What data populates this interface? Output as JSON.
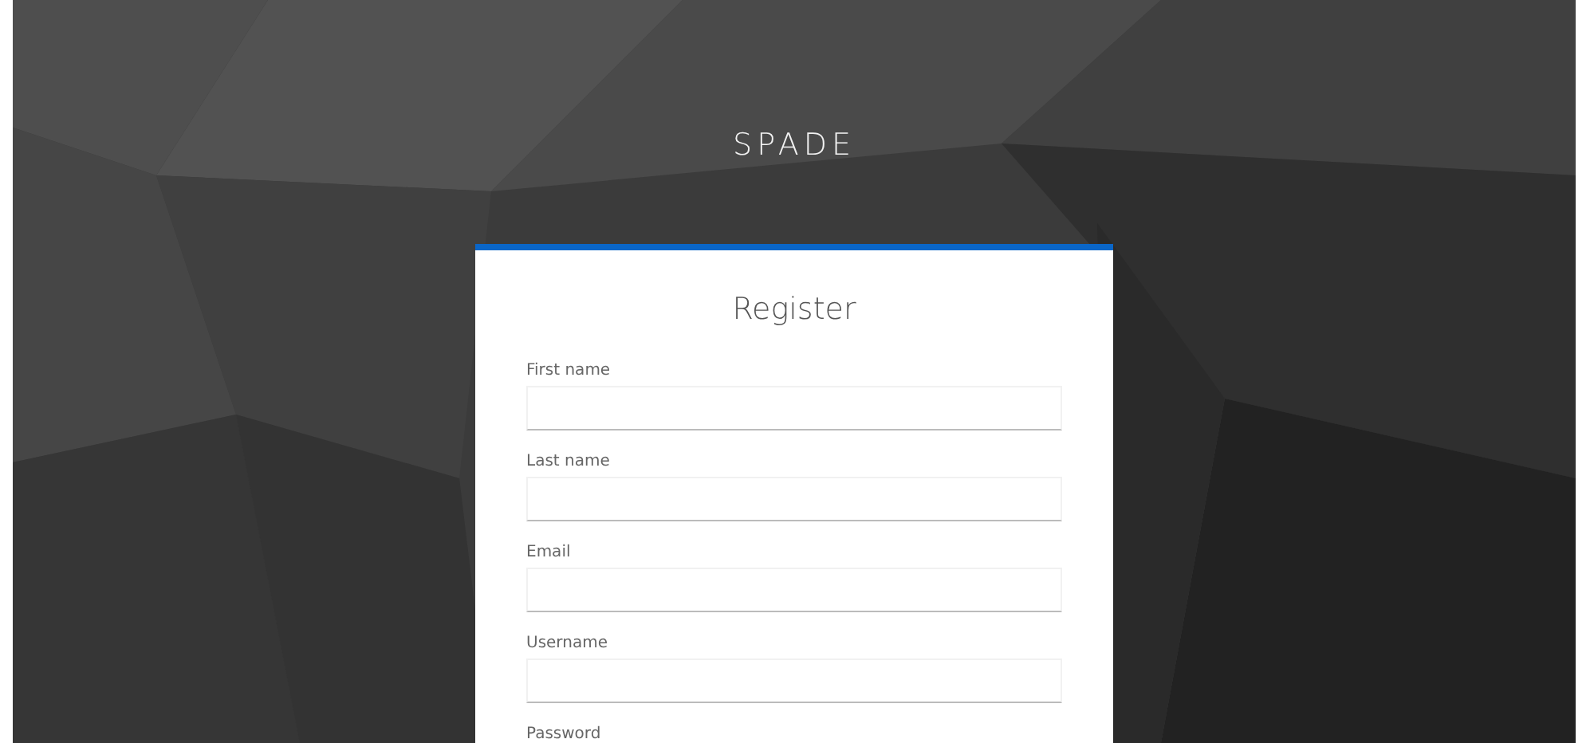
{
  "brand": "SPADE",
  "form": {
    "heading": "Register",
    "fields": [
      {
        "label": "First name"
      },
      {
        "label": "Last name"
      },
      {
        "label": "Email"
      },
      {
        "label": "Username"
      },
      {
        "label": "Password"
      }
    ]
  }
}
